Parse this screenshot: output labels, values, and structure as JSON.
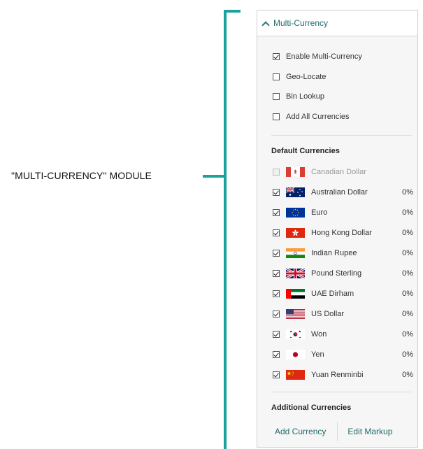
{
  "annotation": {
    "label": "\"MULTI-CURRENCY\" MODULE"
  },
  "panel": {
    "title": "Multi-Currency",
    "options": [
      {
        "label": "Enable Multi-Currency",
        "checked": true
      },
      {
        "label": "Geo-Locate",
        "checked": false
      },
      {
        "label": "Bin Lookup",
        "checked": false
      },
      {
        "label": "Add All Currencies",
        "checked": false
      }
    ],
    "default_currencies": {
      "heading": "Default Currencies",
      "items": [
        {
          "name": "Canadian Dollar",
          "pct": "",
          "checked": false,
          "disabled": true,
          "flag": "canada-flag-icon"
        },
        {
          "name": "Australian Dollar",
          "pct": "0%",
          "checked": true,
          "disabled": false,
          "flag": "australia-flag-icon"
        },
        {
          "name": "Euro",
          "pct": "0%",
          "checked": true,
          "disabled": false,
          "flag": "eu-flag-icon"
        },
        {
          "name": "Hong Kong Dollar",
          "pct": "0%",
          "checked": true,
          "disabled": false,
          "flag": "hong-kong-flag-icon"
        },
        {
          "name": "Indian Rupee",
          "pct": "0%",
          "checked": true,
          "disabled": false,
          "flag": "india-flag-icon"
        },
        {
          "name": "Pound Sterling",
          "pct": "0%",
          "checked": true,
          "disabled": false,
          "flag": "uk-flag-icon"
        },
        {
          "name": "UAE Dirham",
          "pct": "0%",
          "checked": true,
          "disabled": false,
          "flag": "uae-flag-icon"
        },
        {
          "name": "US Dollar",
          "pct": "0%",
          "checked": true,
          "disabled": false,
          "flag": "us-flag-icon"
        },
        {
          "name": "Won",
          "pct": "0%",
          "checked": true,
          "disabled": false,
          "flag": "south-korea-flag-icon"
        },
        {
          "name": "Yen",
          "pct": "0%",
          "checked": true,
          "disabled": false,
          "flag": "japan-flag-icon"
        },
        {
          "name": "Yuan Renminbi",
          "pct": "0%",
          "checked": true,
          "disabled": false,
          "flag": "china-flag-icon"
        }
      ]
    },
    "additional_currencies": {
      "heading": "Additional Currencies",
      "add_label": "Add Currency",
      "edit_label": "Edit Markup"
    }
  },
  "colors": {
    "accent": "#1aa39e",
    "link": "#1f6e6a"
  }
}
